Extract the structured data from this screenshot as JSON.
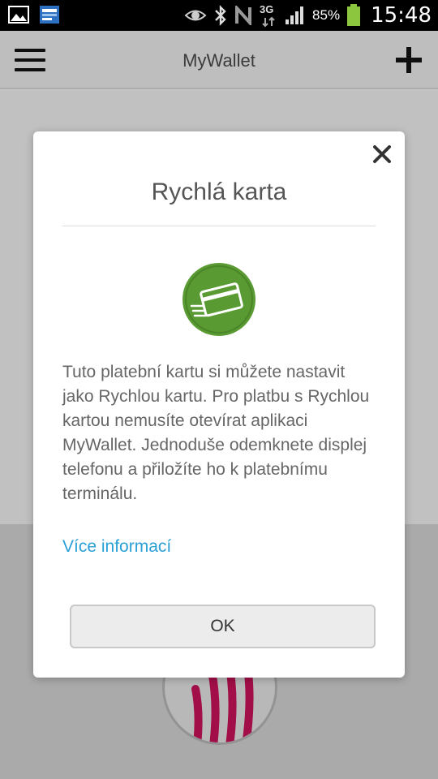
{
  "status_bar": {
    "battery_percent": "85%",
    "time": "15:48",
    "network_type": "3G",
    "icons": [
      "image-icon",
      "app-notification-icon",
      "eye-icon",
      "bluetooth-icon",
      "nfc-icon",
      "network-3g-icon",
      "signal-icon",
      "battery-icon"
    ]
  },
  "app_bar": {
    "title": "MyWallet",
    "menu_icon": "hamburger-menu-icon",
    "add_icon": "plus-icon"
  },
  "dialog": {
    "title": "Rychlá karta",
    "icon": "quick-card-icon",
    "icon_color": "#5a9a32",
    "body": "Tuto platební kartu si můžete nastavit jako Rychlou kartu. Pro platbu s Rychlou kartou nemusíte otevírat aplikaci MyWallet. Jednoduše odemknete displej telefonu a přiložíte ho k platebnímu terminálu.",
    "more_info_link": "Více informací",
    "ok_button": "OK",
    "link_color": "#2aa0d6"
  },
  "background": {
    "nfc_icon": "contactless-payment-icon",
    "nfc_color": "#b0104e"
  }
}
